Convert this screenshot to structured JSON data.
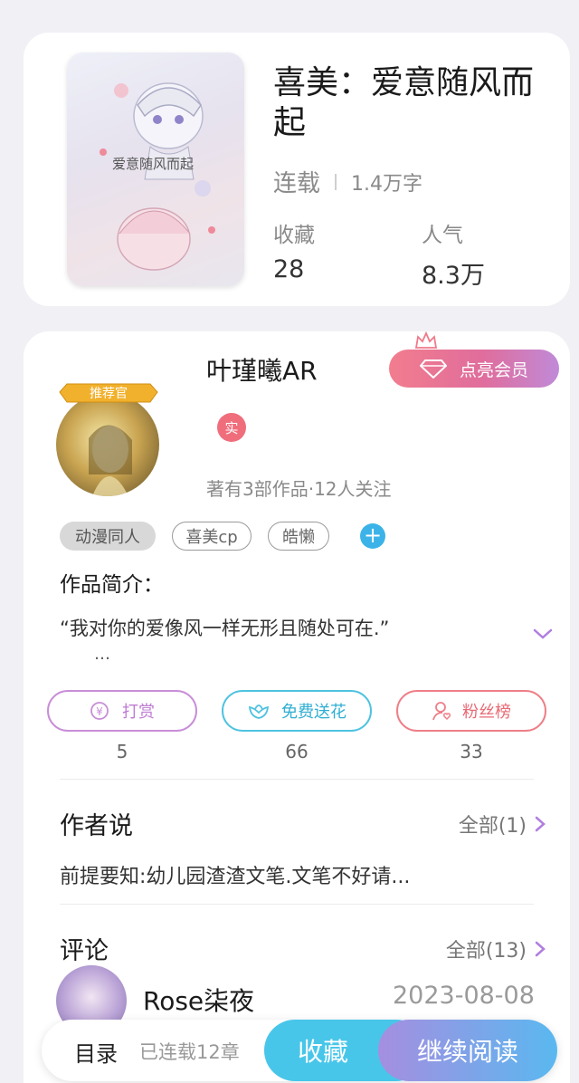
{
  "book": {
    "title": "喜美：爱意随风而起",
    "status": "连载",
    "word_count": "1.4万字",
    "stats": [
      {
        "label": "收藏",
        "value": "28"
      },
      {
        "label": "人气",
        "value": "8.3万"
      }
    ],
    "cover_text": "爱意随风而起"
  },
  "author": {
    "name": "叶瑾曦AR",
    "badge": "推荐官",
    "verified_label": "实",
    "stats_text": "著有3部作品·12人关注",
    "vip_button": "点亮会员",
    "tags": [
      "动漫同人",
      "喜美cp",
      "皓懒"
    ],
    "add_tag": "+"
  },
  "intro": {
    "title": "作品简介：",
    "text": "“我对你的爱像风一样无形且随处可在.”",
    "more": "…"
  },
  "actions": [
    {
      "label": "打赏",
      "count": "5",
      "color": "#c88ed8"
    },
    {
      "label": "免费送花",
      "count": "66",
      "color": "#4fc3e0"
    },
    {
      "label": "粉丝榜",
      "count": "33",
      "color": "#ee7f88"
    }
  ],
  "author_says": {
    "title": "作者说",
    "more": "全部(1)",
    "text": "前提要知:幼儿园渣渣文笔.文笔不好请..."
  },
  "comments": {
    "title": "评论",
    "more": "全部(13)",
    "first": {
      "user": "Rose柒夜",
      "date": "2023-08-08"
    }
  },
  "bottom_bar": {
    "toc": "目录",
    "chapters": "已连载12章",
    "favorite": "收藏",
    "continue": "继续阅读"
  },
  "colors": {
    "accent_purple": "#b07ee0",
    "accent_blue": "#48c6ea",
    "accent_pink": "#f06e7c"
  }
}
